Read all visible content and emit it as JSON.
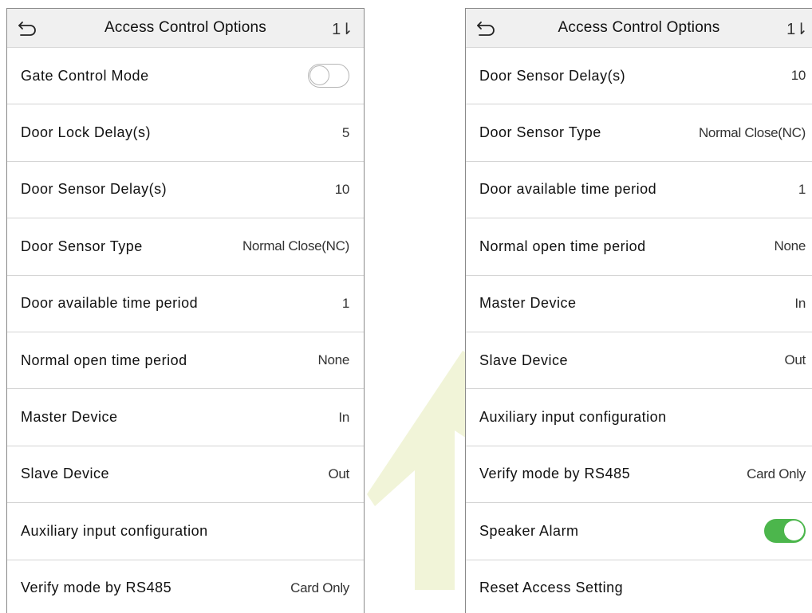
{
  "colors": {
    "toggle_on": "#4cb64c",
    "header_bg": "#f0f0f0",
    "watermark": "#f1f4d8"
  },
  "left_screen": {
    "title": "Access Control Options",
    "back_icon": "back-arrow-icon",
    "sort_icon": "sort-icon",
    "sort_glyph": "1⇂",
    "rows": [
      {
        "label": "Gate Control Mode",
        "value": "",
        "toggle": "off"
      },
      {
        "label": "Door Lock Delay(s)",
        "value": "5"
      },
      {
        "label": "Door Sensor Delay(s)",
        "value": "10"
      },
      {
        "label": "Door Sensor Type",
        "value": "Normal Close(NC)"
      },
      {
        "label": "Door available time period",
        "value": "1"
      },
      {
        "label": "Normal open time period",
        "value": "None"
      },
      {
        "label": "Master Device",
        "value": "In"
      },
      {
        "label": "Slave Device",
        "value": "Out"
      },
      {
        "label": "Auxiliary input configuration",
        "value": ""
      },
      {
        "label": "Verify mode by RS485",
        "value": "Card Only"
      }
    ]
  },
  "right_screen": {
    "title": "Access Control Options",
    "back_icon": "back-arrow-icon",
    "sort_icon": "sort-icon",
    "sort_glyph": "1⇂",
    "rows": [
      {
        "label": "Door Sensor Delay(s)",
        "value": "10"
      },
      {
        "label": "Door Sensor Type",
        "value": "Normal Close(NC)"
      },
      {
        "label": "Door available time period",
        "value": "1"
      },
      {
        "label": "Normal open time period",
        "value": "None"
      },
      {
        "label": "Master Device",
        "value": "In"
      },
      {
        "label": "Slave Device",
        "value": "Out"
      },
      {
        "label": "Auxiliary input configuration",
        "value": ""
      },
      {
        "label": "Verify mode by RS485",
        "value": "Card Only"
      },
      {
        "label": "Speaker Alarm",
        "value": "",
        "toggle": "on"
      },
      {
        "label": "Reset Access Setting",
        "value": ""
      }
    ]
  }
}
